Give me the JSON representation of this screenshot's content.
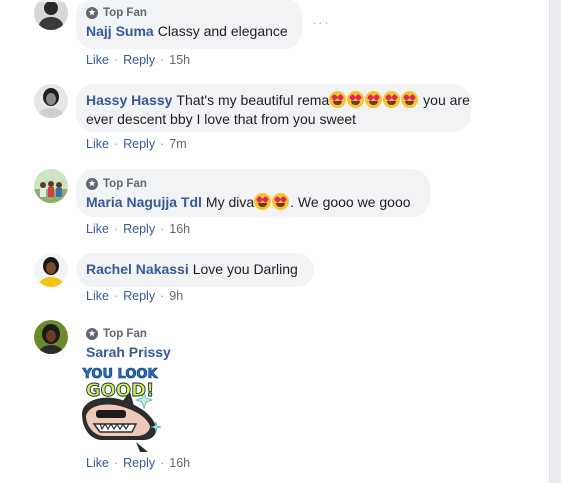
{
  "comments": [
    {
      "badge": "Top Fan",
      "author": "Najj Suma",
      "text": "Classy and elegance",
      "like": "Like",
      "reply": "Reply",
      "time": "15h"
    },
    {
      "author": "Hassy Hassy",
      "text_before": "That's my beautiful rema",
      "text_after": " you are",
      "text_line2": "ever descent bby I love that from you sweet",
      "like": "Like",
      "reply": "Reply",
      "time": "7m"
    },
    {
      "badge": "Top Fan",
      "author": "Maria Nagujja Tdl",
      "text_before": "My diva",
      "text_after": ". We gooo we gooo",
      "like": "Like",
      "reply": "Reply",
      "time": "16h"
    },
    {
      "author": "Rachel Nakassi",
      "text": "Love you Darling",
      "like": "Like",
      "reply": "Reply",
      "time": "9h"
    },
    {
      "badge": "Top Fan",
      "author": "Sarah Prissy",
      "sticker_line1": "YOU LOOK",
      "sticker_line2": "GOOD!",
      "like": "Like",
      "reply": "Reply",
      "time": "16h"
    }
  ],
  "more_icon": "···",
  "colors": {
    "link": "#385898",
    "bubble": "#f2f3f5",
    "meta": "#606770"
  }
}
